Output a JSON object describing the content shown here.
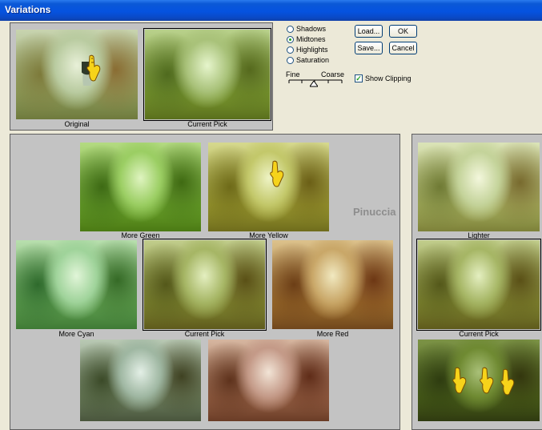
{
  "window": {
    "title": "Variations"
  },
  "top_previews": {
    "original_label": "Original",
    "current_label": "Current Pick"
  },
  "tone_options": {
    "items": [
      {
        "label": "Shadows",
        "selected": false
      },
      {
        "label": "Midtones",
        "selected": true
      },
      {
        "label": "Highlights",
        "selected": false
      },
      {
        "label": "Saturation",
        "selected": false
      }
    ]
  },
  "slider": {
    "fine_label": "Fine",
    "coarse_label": "Coarse",
    "level": 0.5
  },
  "show_clipping": {
    "label": "Show Clipping",
    "checked": true
  },
  "buttons": {
    "load": "Load...",
    "ok": "OK",
    "save": "Save...",
    "cancel": "Cancel"
  },
  "variations": {
    "more_green": "More Green",
    "more_yellow": "More Yellow",
    "more_cyan": "More Cyan",
    "current_pick": "Current Pick",
    "more_red": "More Red"
  },
  "watermark": "Pinuccia",
  "brightness": {
    "lighter": "Lighter",
    "current_pick": "Current Pick"
  },
  "colors": {
    "titlebar": "#0553e0",
    "dialog_bg": "#ece9d8",
    "panel_bg": "#c3c3c3"
  }
}
